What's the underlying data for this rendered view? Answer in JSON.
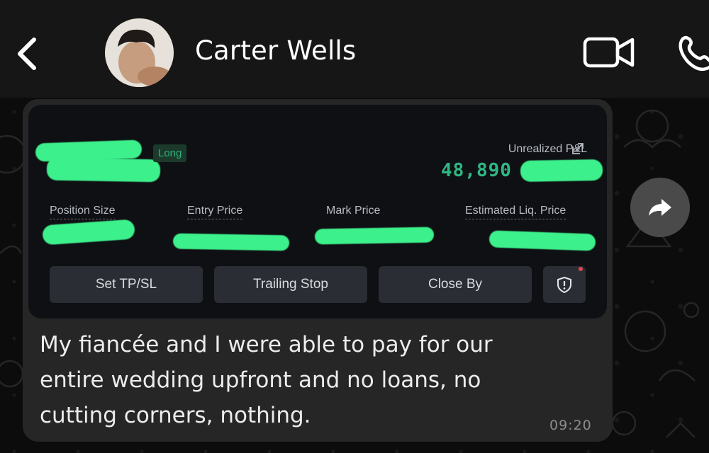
{
  "header": {
    "contact_name": "Carter Wells",
    "icons": [
      "back-arrow-icon",
      "avatar",
      "video-call-icon",
      "phone-call-icon"
    ]
  },
  "message": {
    "screenshot": {
      "position_side": "Long",
      "unrealized_pnl_label": "Unrealized P&L",
      "unrealized_pnl_value": "48,890",
      "columns": [
        "Position Size",
        "Entry Price",
        "Mark Price",
        "Estimated Liq. Price"
      ],
      "buttons": [
        "Set TP/SL",
        "Trailing Stop",
        "Close By"
      ],
      "redaction_color": "#3cf08b",
      "pnl_color": "#2fb884"
    },
    "text": "My fiancée and I were able to pay for our\nentire wedding upfront and  no loans, no\ncutting corners, nothing.",
    "time": "09:20"
  },
  "colors": {
    "header_bg": "#161616",
    "bubble_bg": "#262626",
    "chat_bg": "#0c0c0c"
  }
}
